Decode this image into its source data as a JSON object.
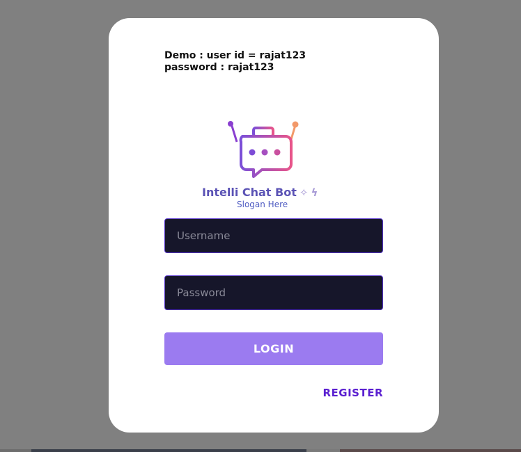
{
  "demo": {
    "line1": "Demo : user id = rajat123",
    "line2": "password : rajat123"
  },
  "logo": {
    "name": "Intelli Chat Bot",
    "slogan": "Slogan Here",
    "sparkle1": "✧",
    "sparkle2": "ϟ",
    "icon": "robot-chat-icon",
    "colors": {
      "gradient_start": "#7b4fd8",
      "gradient_end": "#e8558a",
      "antenna_left": "#8a3fd0",
      "antenna_right": "#f2996a"
    }
  },
  "form": {
    "username_placeholder": "Username",
    "password_placeholder": "Password",
    "login_label": "LOGIN",
    "register_label": "REGISTER"
  },
  "colors": {
    "backdrop": "#808080",
    "card": "#ffffff",
    "input_bg": "#16162a",
    "input_border": "#5533cc",
    "button": "#9b7bf0",
    "register": "#5a1fd0"
  }
}
